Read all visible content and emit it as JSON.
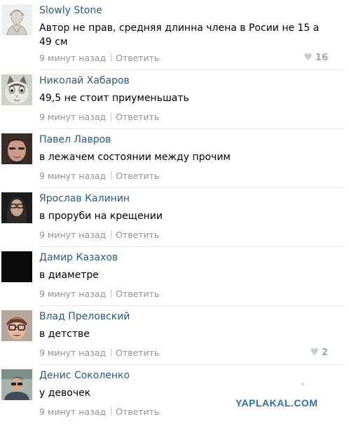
{
  "comments": [
    {
      "author": "Slowly Stone",
      "text": "Автор не прав, средняя длинна члена в Росии не 15 а 49 см",
      "time": "9 минут назад",
      "reply": "Ответить",
      "likes": "16",
      "avatar": "avatar-sketch"
    },
    {
      "author": "Николай Хабаров",
      "text": "49,5 не стоит приуменьшать",
      "time": "9 минут назад",
      "reply": "Ответить",
      "likes": "",
      "avatar": "avatar-cat"
    },
    {
      "author": "Павел Лавров",
      "text": "в лежачем состоянии между прочим",
      "time": "9 минут назад",
      "reply": "Ответить",
      "likes": "",
      "avatar": "avatar-face-dark"
    },
    {
      "author": "Ярослав Калинин",
      "text": "в проруби на крещении",
      "time": "9 минут назад",
      "reply": "Ответить",
      "likes": "",
      "avatar": "avatar-bearded-man"
    },
    {
      "author": "Дамир Казахов",
      "text": "в диаметре",
      "time": "9 минут назад",
      "reply": "Ответить",
      "likes": "",
      "avatar": "avatar-black"
    },
    {
      "author": "Влад Преловский",
      "text": "в детстве",
      "time": "9 минут назад",
      "reply": "Ответить",
      "likes": "2",
      "avatar": "avatar-glasses"
    },
    {
      "author": "Денис Соколенко",
      "text": "у девочек",
      "time": "9 минут назад",
      "reply": "Ответить",
      "likes": "",
      "avatar": "avatar-photo"
    }
  ],
  "watermark": "YAPLAKAL.COM",
  "colors": {
    "author": "#2a5885",
    "meta": "#939393",
    "like": "#9aa8b8",
    "watermark": "#2a6fb1"
  },
  "icons": {
    "like": "heart-icon"
  }
}
